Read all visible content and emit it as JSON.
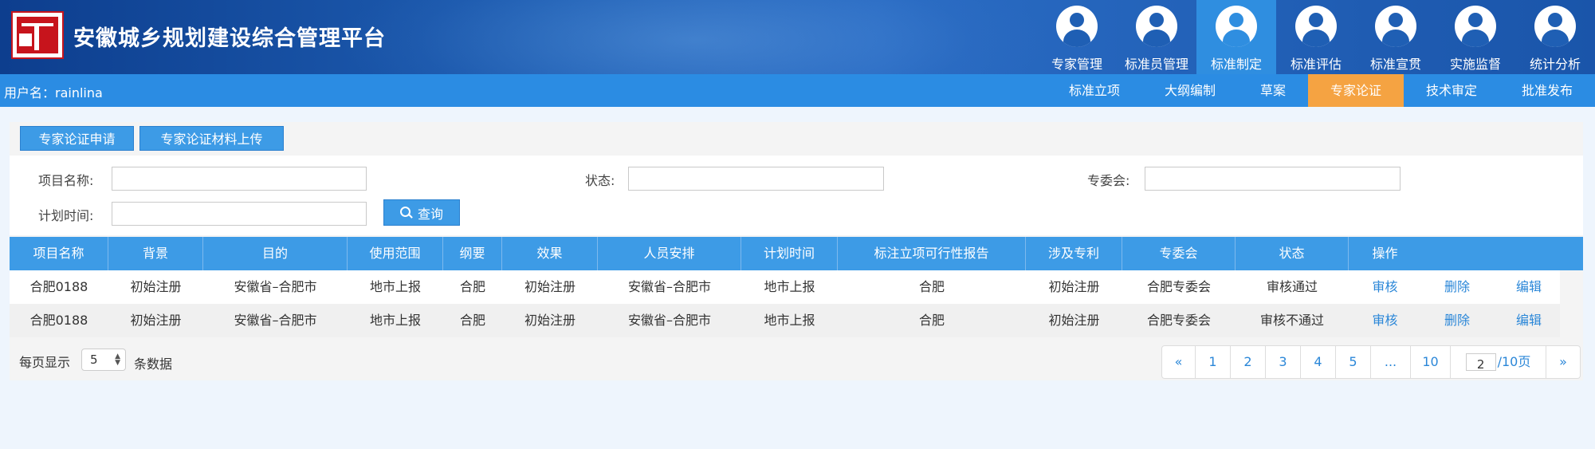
{
  "header": {
    "app_title": "安徽城乡规划建设综合管理平台",
    "nav": [
      {
        "label": "专家管理",
        "active": false
      },
      {
        "label": "标准员管理",
        "active": false
      },
      {
        "label": "标准制定",
        "active": true
      },
      {
        "label": "标准评估",
        "active": false
      },
      {
        "label": "标准宣贯",
        "active": false
      },
      {
        "label": "实施监督",
        "active": false
      },
      {
        "label": "统计分析",
        "active": false
      }
    ]
  },
  "subbar": {
    "username": "用户名：rainlina",
    "tabs": [
      {
        "label": "标准立项",
        "active": false
      },
      {
        "label": "大纲编制",
        "active": false
      },
      {
        "label": "草案",
        "active": false
      },
      {
        "label": "专家论证",
        "active": true
      },
      {
        "label": "技术审定",
        "active": false
      },
      {
        "label": "批准发布",
        "active": false
      }
    ]
  },
  "actions": {
    "apply_label": "专家论证申请",
    "upload_label": "专家论证材料上传"
  },
  "search": {
    "project_name_label": "项目名称:",
    "project_name_value": "",
    "status_label": "状态:",
    "status_value": "",
    "committee_label": "专委会:",
    "committee_value": "",
    "plan_time_label": "计划时间:",
    "plan_time_value": "",
    "query_label": "查询"
  },
  "table": {
    "headers": [
      "项目名称",
      "背景",
      "目的",
      "使用范围",
      "纲要",
      "效果",
      "人员安排",
      "计划时间",
      "标注立项可行性报告",
      "涉及专利",
      "专委会",
      "状态",
      "操作"
    ],
    "rows": [
      {
        "name": "合肥0188",
        "background": "初始注册",
        "purpose": "安徽省–合肥市",
        "scope": "地市上报",
        "outline": "合肥",
        "effect": "初始注册",
        "staff": "安徽省–合肥市",
        "plan_time": "地市上报",
        "report": "合肥",
        "patent": "初始注册",
        "committee": "合肥专委会",
        "status": "审核通过",
        "op_review": "审核",
        "op_delete": "删除",
        "op_edit": "编辑"
      },
      {
        "name": "合肥0188",
        "background": "初始注册",
        "purpose": "安徽省–合肥市",
        "scope": "地市上报",
        "outline": "合肥",
        "effect": "初始注册",
        "staff": "安徽省–合肥市",
        "plan_time": "地市上报",
        "report": "合肥",
        "patent": "初始注册",
        "committee": "合肥专委会",
        "status": "审核不通过",
        "op_review": "审核",
        "op_delete": "删除",
        "op_edit": "编辑"
      }
    ]
  },
  "footer": {
    "per_page_prefix": "每页显示",
    "per_page_value": "5",
    "per_page_suffix": "条数据",
    "pager": {
      "prev": "«",
      "pages": [
        "1",
        "2",
        "3",
        "4",
        "5"
      ],
      "ellipsis": "...",
      "last": "10",
      "jump_value": "2",
      "jump_suffix": "/10页",
      "next": "»"
    }
  },
  "colors": {
    "header_bg": "#1f5fb4",
    "nav_active": "#2f8ee0",
    "subbar_bg": "#2b8ce3",
    "tab_active": "#f5a342",
    "button_bg": "#3d9be6",
    "link": "#2b87d8"
  }
}
